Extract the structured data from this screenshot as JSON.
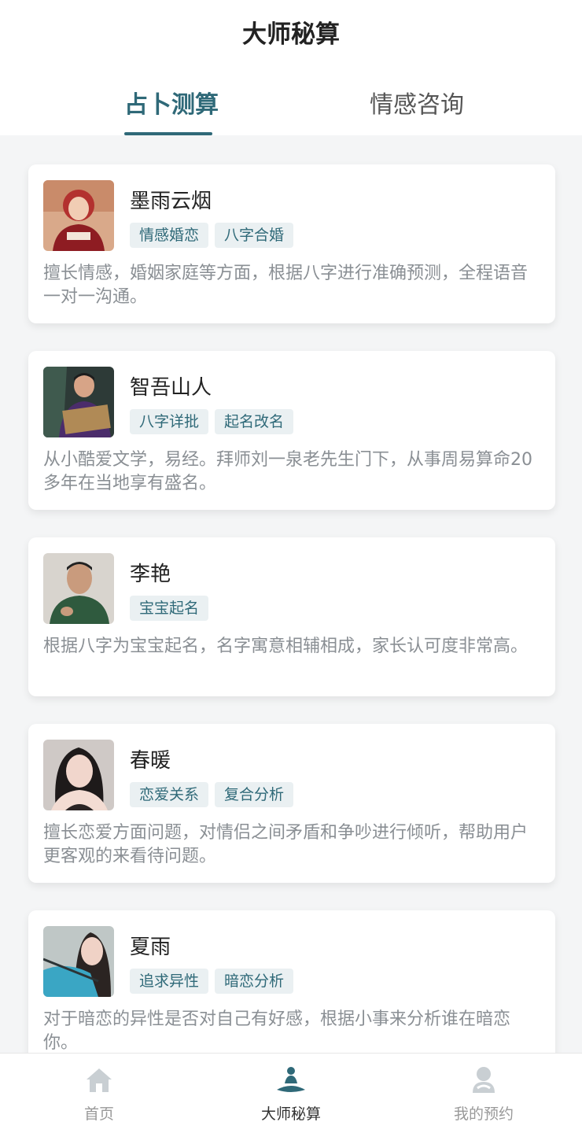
{
  "header": {
    "title": "大师秘算",
    "tabs": [
      {
        "label": "占卜测算",
        "active": true
      },
      {
        "label": "情感咨询",
        "active": false
      }
    ]
  },
  "masters": [
    {
      "name": "墨雨云烟",
      "tags": [
        "情感婚恋",
        "八字合婚"
      ],
      "desc": "擅长情感，婚姻家庭等方面，根据八字进行准确预测，全程语音一对一沟通。"
    },
    {
      "name": "智吾山人",
      "tags": [
        "八字详批",
        "起名改名"
      ],
      "desc": "从小酷爱文学，易经。拜师刘一泉老先生门下，从事周易算命20多年在当地享有盛名。"
    },
    {
      "name": "李艳",
      "tags": [
        "宝宝起名"
      ],
      "desc": "根据八字为宝宝起名，名字寓意相辅相成，家长认可度非常高。"
    },
    {
      "name": "春暖",
      "tags": [
        "恋爱关系",
        "复合分析"
      ],
      "desc": "擅长恋爱方面问题，对情侣之间矛盾和争吵进行倾听，帮助用户更客观的来看待问题。"
    },
    {
      "name": "夏雨",
      "tags": [
        "追求异性",
        "暗恋分析"
      ],
      "desc": "对于暗恋的异性是否对自己有好感，根据小事来分析谁在暗恋你。"
    }
  ],
  "bottom_nav": [
    {
      "label": "首页",
      "icon": "home-icon",
      "active": false
    },
    {
      "label": "大师秘算",
      "icon": "meditation-icon",
      "active": true
    },
    {
      "label": "我的预约",
      "icon": "profile-icon",
      "active": false
    }
  ],
  "colors": {
    "accent": "#2f6978",
    "tag_bg": "#eaf0f2",
    "desc_text": "#8a8f94",
    "page_bg": "#f4f5f6"
  }
}
